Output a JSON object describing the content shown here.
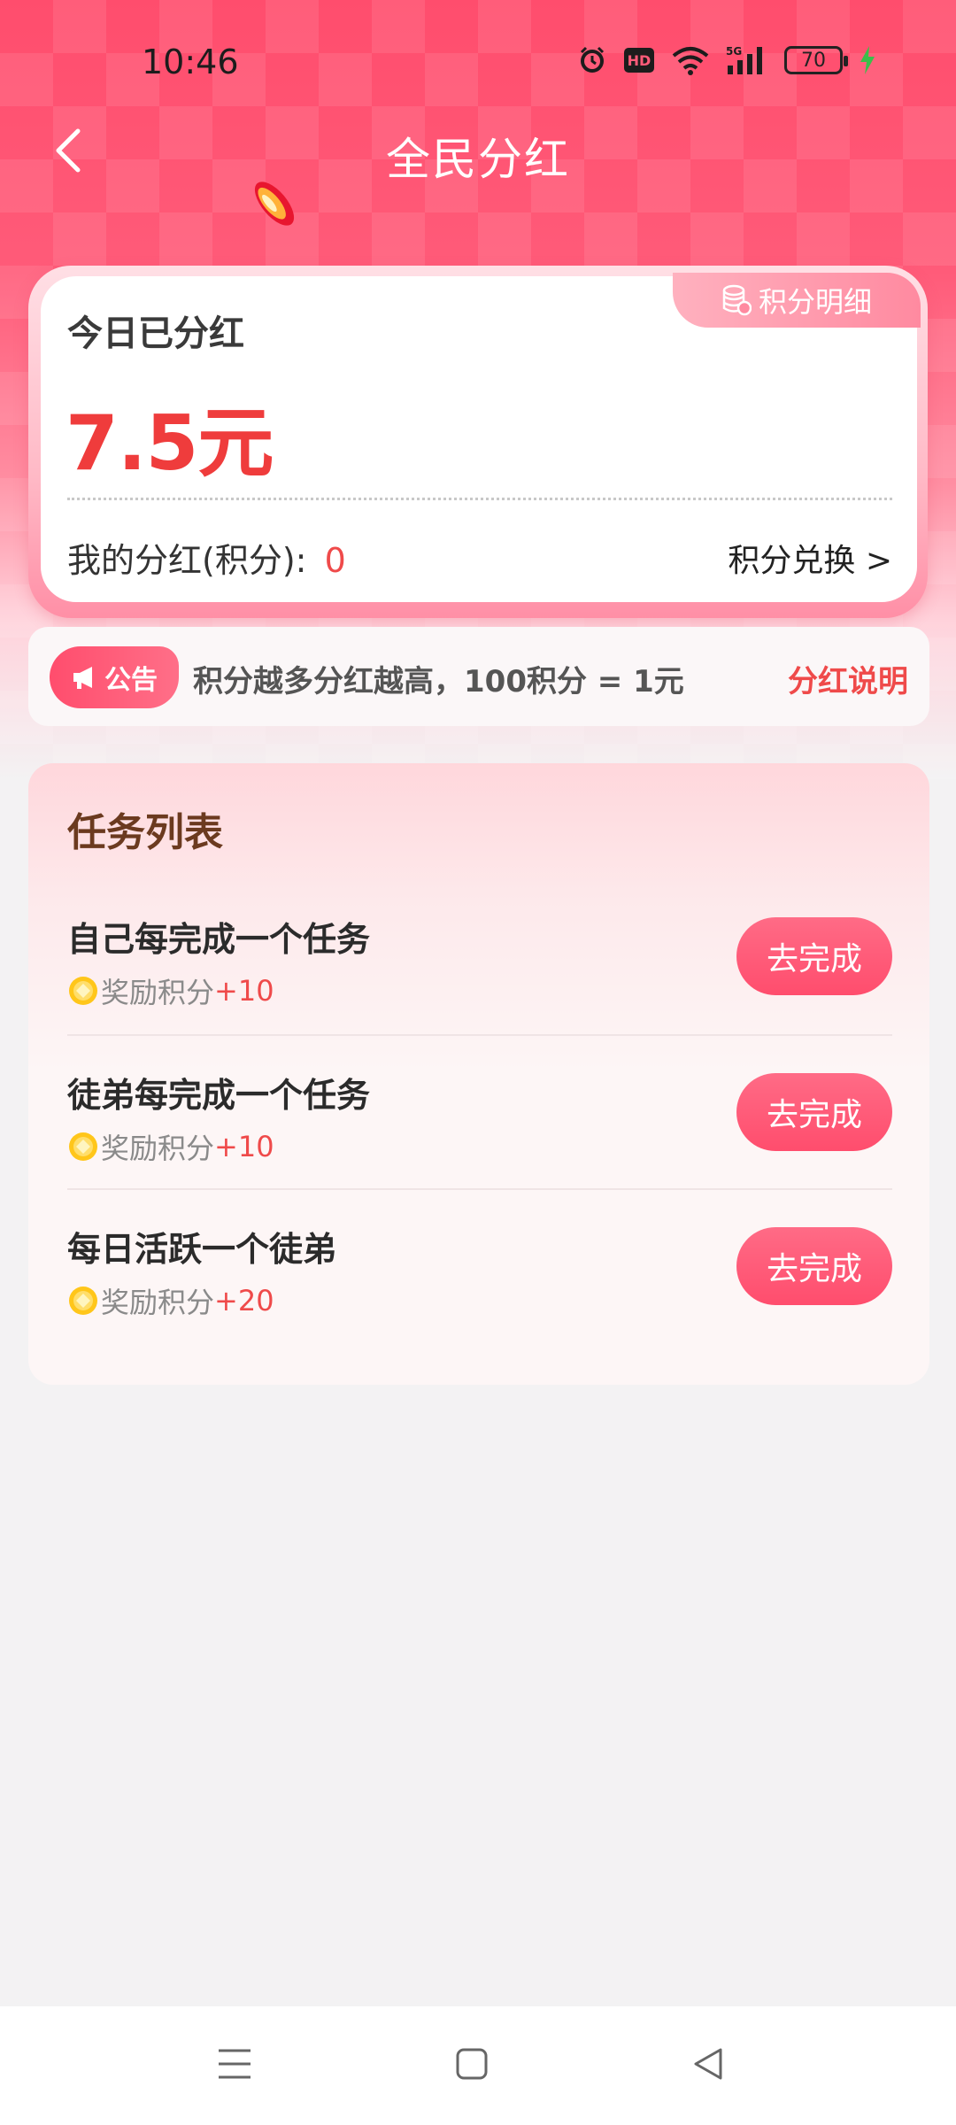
{
  "status_bar": {
    "time": "10:46",
    "battery_level": "70",
    "icons": [
      "alarm-icon",
      "hd-icon",
      "wifi-icon",
      "signal-5g-icon",
      "battery-icon",
      "charging-icon"
    ]
  },
  "header": {
    "title": "全民分红",
    "back_icon": "chevron-left-icon"
  },
  "dividend_card": {
    "detail_label": "积分明细",
    "today_label": "今日已分红",
    "today_amount": "7.5元",
    "my_points_label": "我的分红(积分):",
    "my_points_value": "0",
    "exchange_label": "积分兑换 >"
  },
  "announcement": {
    "tag": "公告",
    "text": "积分越多分红越高，100积分 = 1元",
    "link": "分红说明"
  },
  "task_list": {
    "title": "任务列表",
    "reward_label": "奖励积分",
    "items": [
      {
        "name": "自己每完成一个任务",
        "points": "+10",
        "button": "去完成"
      },
      {
        "name": "徒弟每完成一个任务",
        "points": "+10",
        "button": "去完成"
      },
      {
        "name": "每日活跃一个徒弟",
        "points": "+20",
        "button": "去完成"
      }
    ]
  },
  "colors": {
    "brand": "#ff4d6d",
    "amount_red": "#ef3c3c",
    "task_title": "#6b3a1f",
    "page_bg": "#f3f2f3"
  },
  "nav_bar": {
    "icons": [
      "menu-icon",
      "home-square-icon",
      "back-triangle-icon"
    ]
  }
}
